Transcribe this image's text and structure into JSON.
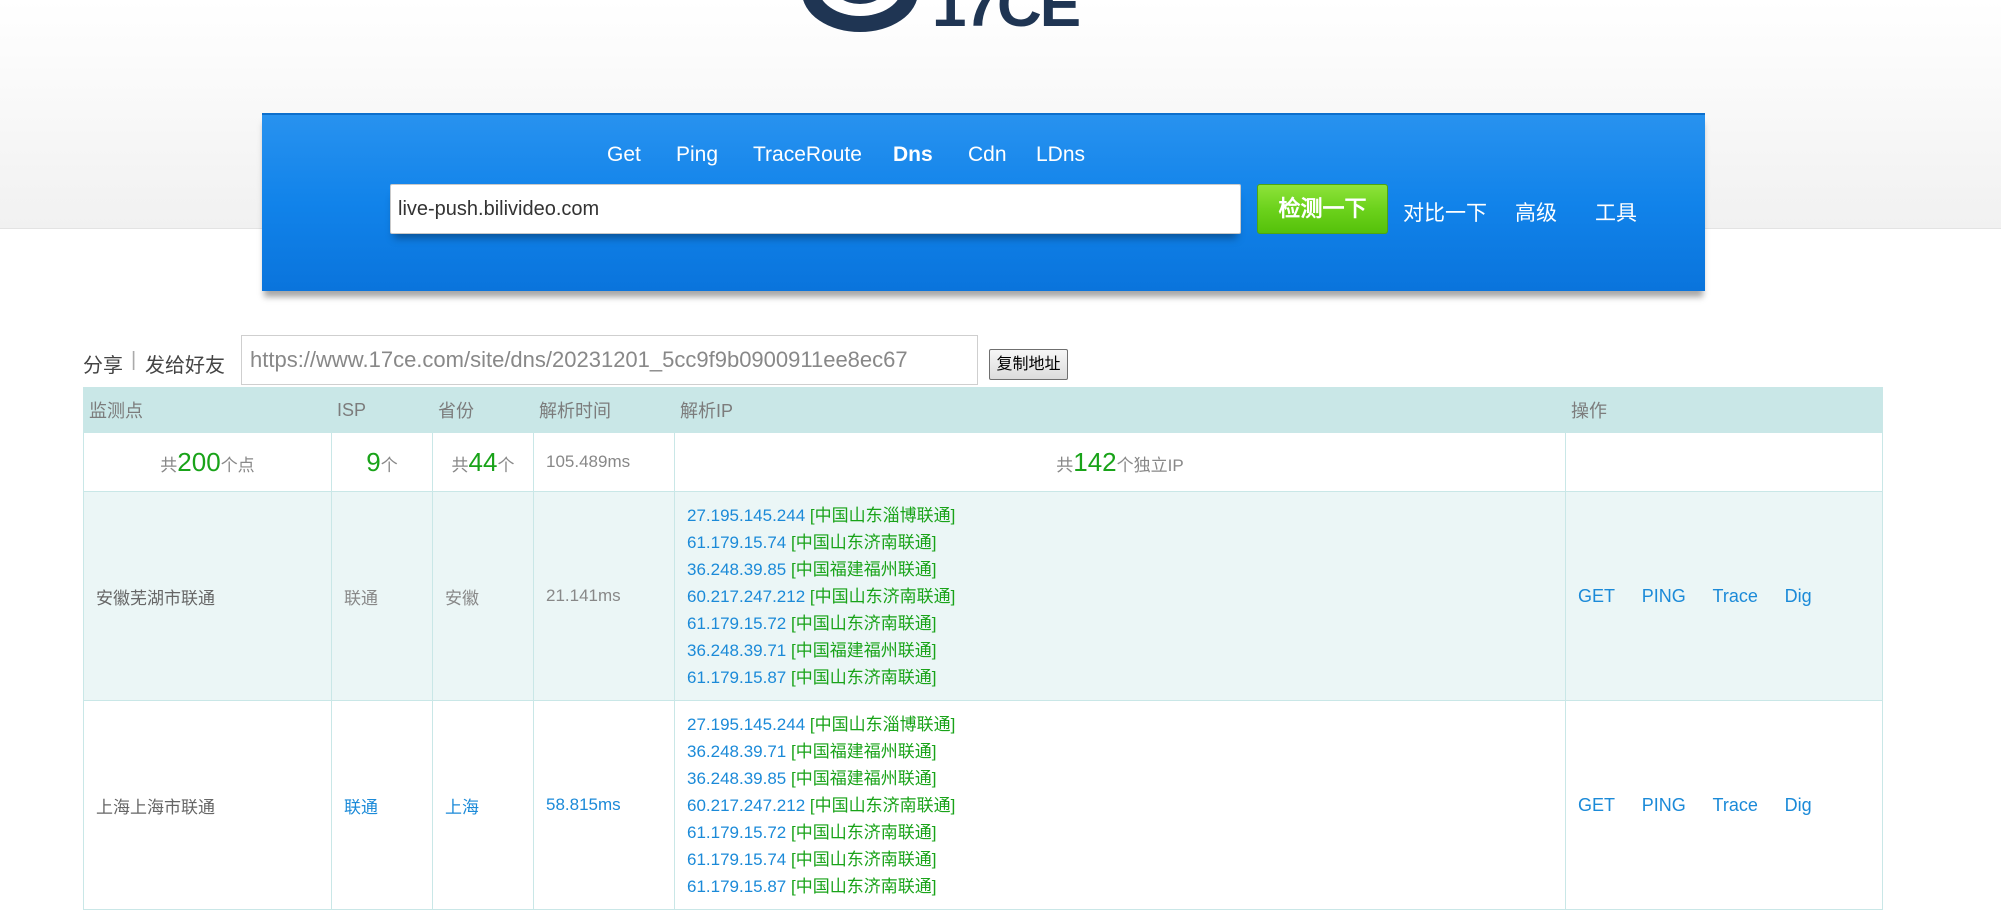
{
  "logo": {
    "text": "17CE"
  },
  "nav_tabs": [
    {
      "label": "Get",
      "active": false
    },
    {
      "label": "Ping",
      "active": false
    },
    {
      "label": "TraceRoute",
      "active": false
    },
    {
      "label": "Dns",
      "active": true
    },
    {
      "label": "Cdn",
      "active": false
    },
    {
      "label": "LDns",
      "active": false
    }
  ],
  "search": {
    "value": "live-push.bilivideo.com",
    "check_label": "检测一下",
    "compare_label": "对比一下",
    "advanced_label": "高级",
    "tools_label": "工具"
  },
  "share": {
    "share_label": "分享",
    "separator": "|",
    "send_label": "发给好友",
    "url": "https://www.17ce.com/site/dns/20231201_5cc9f9b0900911ee8ec67",
    "copy_label": "复制地址"
  },
  "table": {
    "headers": [
      "监测点",
      "ISP",
      "省份",
      "解析时间",
      "解析IP",
      "操作"
    ],
    "summary": {
      "points_prefix": "共",
      "points_count": "200",
      "points_suffix": "个点",
      "isp_count": "9",
      "isp_suffix": "个",
      "prov_prefix": "共",
      "prov_count": "44",
      "prov_suffix": "个",
      "avg_time": "105.489ms",
      "ip_prefix": "共",
      "ip_count": "142",
      "ip_suffix": "个独立IP"
    },
    "rows": [
      {
        "location": "安徽芜湖市联通",
        "isp": "联通",
        "province": "安徽",
        "time": "21.141ms",
        "ips": [
          {
            "ip": "27.195.145.244",
            "loc": "[中国山东淄博联通]"
          },
          {
            "ip": "61.179.15.74",
            "loc": "[中国山东济南联通]"
          },
          {
            "ip": "36.248.39.85",
            "loc": "[中国福建福州联通]"
          },
          {
            "ip": "60.217.247.212",
            "loc": "[中国山东济南联通]"
          },
          {
            "ip": "61.179.15.72",
            "loc": "[中国山东济南联通]"
          },
          {
            "ip": "36.248.39.71",
            "loc": "[中国福建福州联通]"
          },
          {
            "ip": "61.179.15.87",
            "loc": "[中国山东济南联通]"
          }
        ],
        "ops": [
          "GET",
          "PING",
          "Trace",
          "Dig"
        ]
      },
      {
        "location": "上海上海市联通",
        "isp": "联通",
        "province": "上海",
        "time": "58.815ms",
        "ips": [
          {
            "ip": "27.195.145.244",
            "loc": "[中国山东淄博联通]"
          },
          {
            "ip": "36.248.39.71",
            "loc": "[中国福建福州联通]"
          },
          {
            "ip": "36.248.39.85",
            "loc": "[中国福建福州联通]"
          },
          {
            "ip": "60.217.247.212",
            "loc": "[中国山东济南联通]"
          },
          {
            "ip": "61.179.15.72",
            "loc": "[中国山东济南联通]"
          },
          {
            "ip": "61.179.15.74",
            "loc": "[中国山东济南联通]"
          },
          {
            "ip": "61.179.15.87",
            "loc": "[中国山东济南联通]"
          }
        ],
        "ops": [
          "GET",
          "PING",
          "Trace",
          "Dig"
        ]
      }
    ]
  }
}
